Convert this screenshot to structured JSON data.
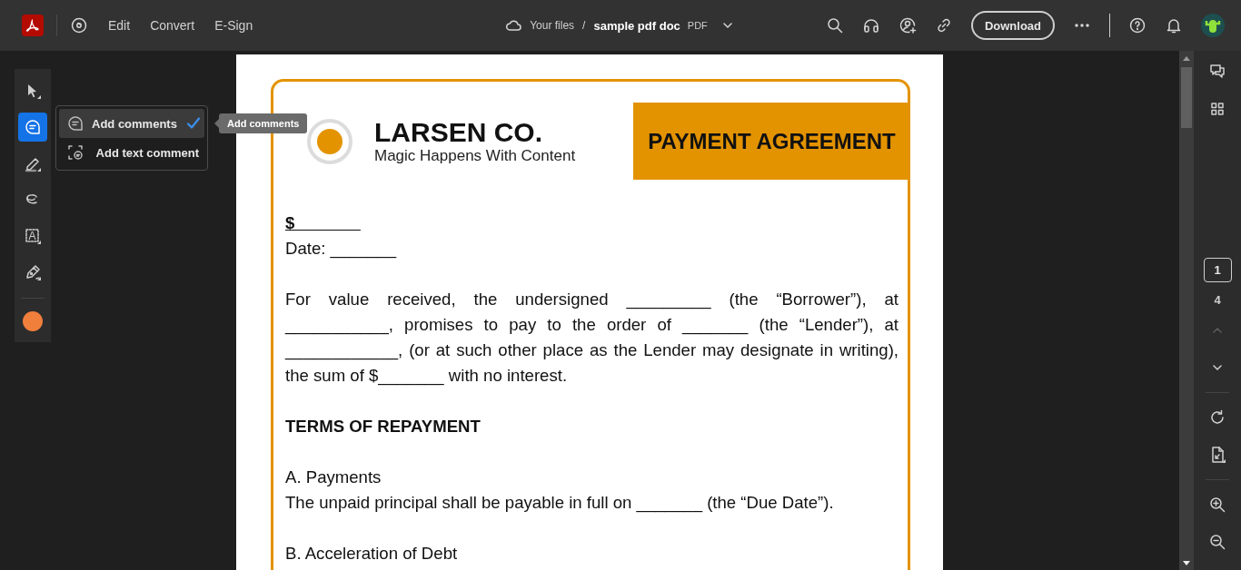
{
  "toolbar": {
    "nav": [
      {
        "label": "Edit"
      },
      {
        "label": "Convert"
      },
      {
        "label": "E-Sign"
      }
    ],
    "breadcrumb": {
      "location": "Your files",
      "separator": "/",
      "file_name": "sample pdf doc",
      "file_type": "PDF"
    },
    "download_button": "Download"
  },
  "tool_rail": {
    "tools": [
      {
        "kind": "select",
        "selected": false
      },
      {
        "kind": "comment",
        "selected": true
      },
      {
        "kind": "highlight",
        "selected": false
      },
      {
        "kind": "draw",
        "selected": false
      },
      {
        "kind": "text-box",
        "label": "A",
        "selected": false
      },
      {
        "kind": "sign",
        "selected": false
      }
    ]
  },
  "comment_menu": {
    "items": [
      {
        "kind": "comment",
        "label": "Add comments",
        "highlighted": true,
        "checked": true
      },
      {
        "kind": "text-comment",
        "label": "Add text comment",
        "highlighted": false,
        "checked": false
      }
    ],
    "tooltip": "Add comments"
  },
  "document": {
    "company": "LARSEN CO.",
    "tagline": "Magic Happens With Content",
    "title": "PAYMENT AGREEMENT",
    "blocks": [
      {
        "kind": "amount",
        "text": "$_______"
      },
      {
        "kind": "line",
        "text": "Date: _______"
      },
      {
        "kind": "paragraph",
        "text": "For value received, the undersigned _________ (the “Borrower”), at ___________, promises to pay to the order of _______ (the “Lender”), at ____________, (or at such other place as the Lender may designate in writing), the sum of $_______ with no interest."
      },
      {
        "kind": "heading",
        "text": "TERMS OF REPAYMENT"
      },
      {
        "kind": "subheading",
        "text": "A. Payments"
      },
      {
        "kind": "line",
        "text": "The unpaid principal shall be payable in full on _______ (the “Due Date”)."
      },
      {
        "kind": "subheading",
        "text": "B. Acceleration of Debt"
      }
    ]
  },
  "page_nav": {
    "current_page": "1",
    "total_pages": "4",
    "previous_disabled": true,
    "next_disabled": false
  }
}
